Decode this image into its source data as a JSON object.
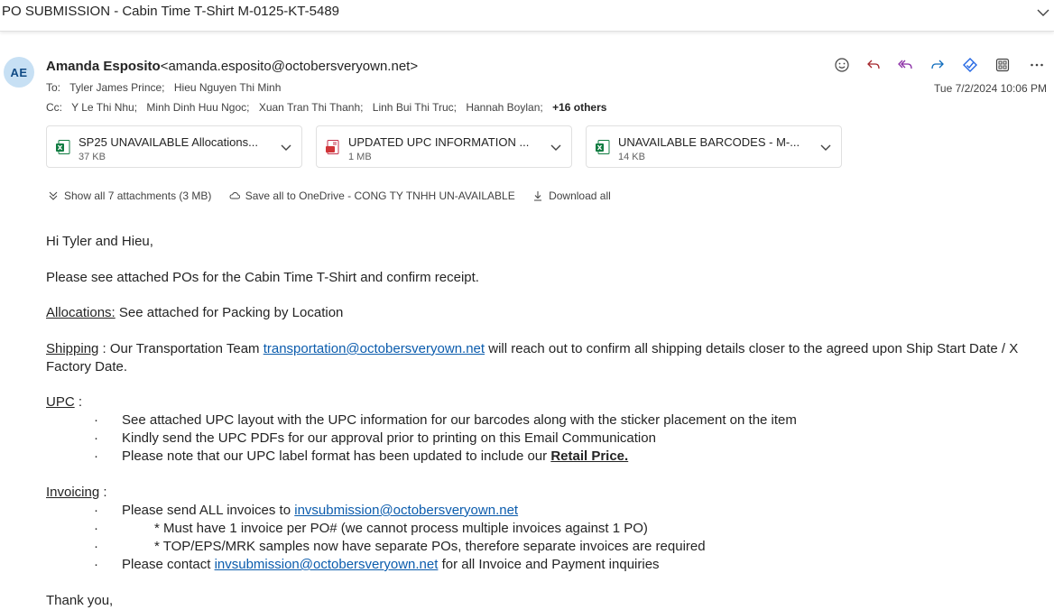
{
  "subject": "PO SUBMISSION - Cabin Time T-Shirt M-0125-KT-5489",
  "sender": {
    "initials": "AE",
    "name": "Amanda Esposito",
    "email": "<amanda.esposito@octobersveryown.net>"
  },
  "to_label": "To:",
  "to": [
    "Tyler James Prince;",
    "Hieu Nguyen Thi Minh"
  ],
  "cc_label": "Cc:",
  "cc": [
    "Y Le Thi Nhu;",
    "Minh Dinh Huu Ngoc;",
    "Xuan Tran Thi Thanh;",
    "Linh Bui Thi Truc;",
    "Hannah Boylan;"
  ],
  "cc_more": "+16 others",
  "date": "Tue 7/2/2024 10:06 PM",
  "attachments": [
    {
      "name": "SP25 UNAVAILABLE Allocations...",
      "size": "37 KB",
      "icon": "excel-file-icon"
    },
    {
      "name": "UPDATED UPC INFORMATION ...",
      "size": "1 MB",
      "icon": "pdf-file-icon"
    },
    {
      "name": "UNAVAILABLE BARCODES - M-...",
      "size": "14 KB",
      "icon": "excel-file-icon"
    }
  ],
  "attachment_links": {
    "show_all": "Show all 7 attachments (3 MB)",
    "save_onedrive": "Save all to OneDrive - CONG TY TNHH UN-AVAILABLE",
    "download_all": "Download all"
  },
  "body": {
    "greeting": "Hi Tyler and Hieu,",
    "intro": "Please see attached POs for the Cabin Time T-Shirt and confirm receipt.",
    "allocations_label": "Allocations:",
    "allocations_text": " See attached for Packing by Location",
    "shipping_label": "Shipping",
    "shipping_pre": " : Our Transportation Team ",
    "shipping_email": "transportation@octobersveryown.net",
    "shipping_post": " will reach out to confirm all shipping details closer to the agreed upon Ship Start Date / X Factory Date.",
    "upc_label": "UPC",
    "upc_colon": " :",
    "bullet": "·",
    "upc_items": [
      "See attached UPC layout with the UPC information for our barcodes along with the sticker placement on the item",
      "Kindly send the UPC PDFs for our approval prior to printing on this Email Communication"
    ],
    "upc_item3_pre": "Please note that our UPC label format has been updated to include our ",
    "upc_item3_bold": "Retail Price.",
    "invoicing_label": "Invoicing",
    "invoicing_colon": " :",
    "inv_item1_pre": "Please send ALL invoices to ",
    "inv_email": "invsubmission@octobersveryown.net",
    "inv_sub1": "* Must have 1 invoice per PO# (we cannot process multiple invoices against 1 PO)",
    "inv_sub2": "* TOP/EPS/MRK samples now have separate POs, therefore separate invoices are required",
    "inv_item4_pre": "Please contact ",
    "inv_item4_post": "  for all Invoice and Payment inquiries",
    "closing": "Thank you,"
  }
}
